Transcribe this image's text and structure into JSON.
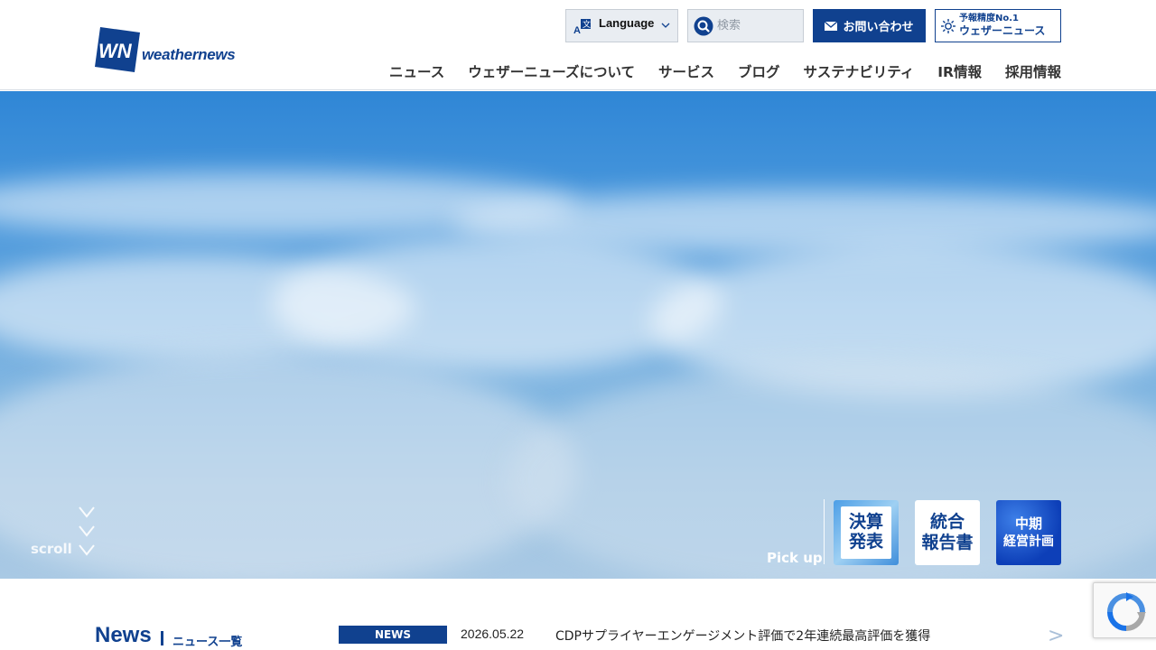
{
  "header": {
    "logo_text": "weathernews",
    "language_label": "Language",
    "search_placeholder": "検索",
    "contact_label": "お問い合わせ",
    "badge_small": "予報精度No.1",
    "badge_big": "ウェザーニュース",
    "nav": [
      "ニュース",
      "ウェザーニューズについて",
      "サービス",
      "ブログ",
      "サステナビリティ",
      "IR情報",
      "採用情報"
    ]
  },
  "hero": {
    "scroll_label": "scroll",
    "pickup_label": "Pick up",
    "tiles": [
      {
        "line1": "決算",
        "line2": "発表"
      },
      {
        "line1": "統合",
        "line2": "報告書"
      },
      {
        "line1": "中期",
        "line2": "経営計画"
      }
    ]
  },
  "news": {
    "title": "News",
    "list_link": "ニュース一覧",
    "items": [
      {
        "tag": "NEWS",
        "date": "2026.05.22",
        "headline": "CDPサプライヤーエンゲージメント評価で2年連続最高評価を獲得"
      }
    ],
    "next_symbol": ">"
  },
  "colors": {
    "brand": "#10418f",
    "sky_top": "#2f86d6",
    "sky_bottom": "#a9c9e4"
  },
  "icons": [
    "wn-logo-icon",
    "language-icon",
    "chevron-down-icon",
    "search-icon",
    "mail-icon",
    "sun-icon",
    "scroll-down-icon",
    "recaptcha-icon"
  ]
}
